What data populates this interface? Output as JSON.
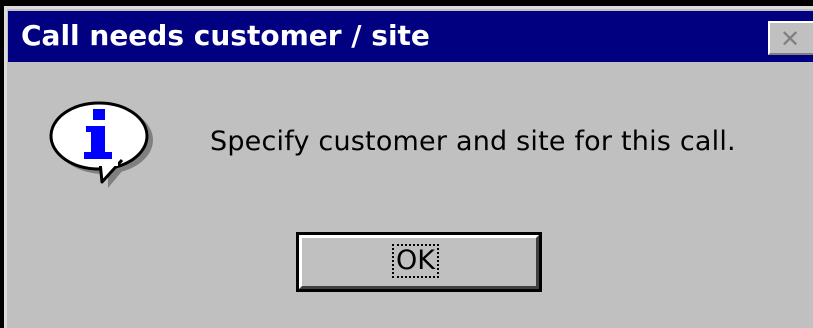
{
  "dialog": {
    "title": "Call needs customer / site",
    "close_icon": "close-icon",
    "icon": "information-icon",
    "message": "Specify customer and site for this call.",
    "ok_label": "OK"
  },
  "colors": {
    "titlebar": "#000080",
    "face": "#c0c0c0",
    "icon_accent": "#0000ff"
  }
}
